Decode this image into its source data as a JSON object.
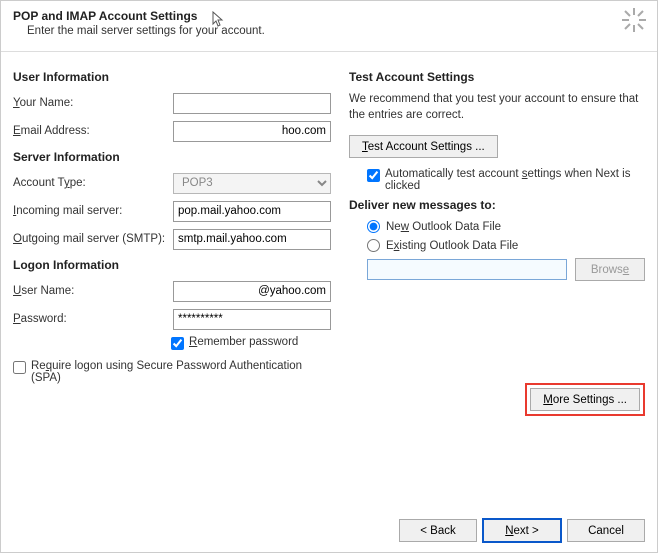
{
  "header": {
    "title": "POP and IMAP Account Settings",
    "subtitle": "Enter the mail server settings for your account."
  },
  "left": {
    "user_info": "User Information",
    "your_name_lbl": "Your Name:",
    "your_name_val": "",
    "email_lbl": "Email Address:",
    "email_val": "hoo.com",
    "server_info": "Server Information",
    "acct_type_lbl": "Account Type:",
    "acct_type_val": "POP3",
    "incoming_lbl": "Incoming mail server:",
    "incoming_val": "pop.mail.yahoo.com",
    "outgoing_lbl": "Outgoing mail server (SMTP):",
    "outgoing_val": "smtp.mail.yahoo.com",
    "logon_info": "Logon Information",
    "username_lbl": "User Name:",
    "username_val": "@yahoo.com",
    "password_lbl": "Password:",
    "password_val": "**********",
    "remember_lbl": "Remember password",
    "spa_lbl": "Require logon using Secure Password Authentication (SPA)"
  },
  "right": {
    "test_head": "Test Account Settings",
    "test_para": "We recommend that you test your account to ensure that the entries are correct.",
    "test_btn": "Test Account Settings ...",
    "auto_test_lbl_a": "Automatically test account settings when Next is clicked",
    "deliver_head": "Deliver new messages to:",
    "new_file_lbl": "New Outlook Data File",
    "existing_file_lbl": "Existing Outlook Data File",
    "browse_btn": "Browse",
    "more_settings_btn": "More Settings ..."
  },
  "footer": {
    "back": "< Back",
    "next": "Next >",
    "cancel": "Cancel"
  }
}
